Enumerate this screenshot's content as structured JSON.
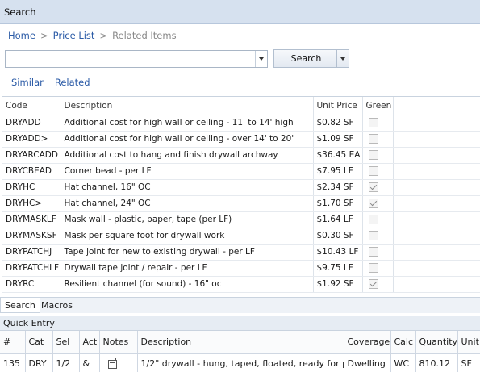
{
  "window": {
    "title": "Search"
  },
  "breadcrumb": {
    "home": "Home",
    "sep": ">",
    "price_list": "Price List",
    "current": "Related Items"
  },
  "search": {
    "value": "",
    "placeholder": "",
    "button_label": "Search"
  },
  "subtabs": {
    "similar": "Similar",
    "related": "Related"
  },
  "results": {
    "headers": {
      "code": "Code",
      "description": "Description",
      "unit_price": "Unit Price",
      "green": "Green"
    },
    "rows": [
      {
        "code": "DRYADD",
        "description": "Additional cost for high wall or ceiling - 11' to 14' high",
        "unit_price": "$0.82 SF",
        "green": false
      },
      {
        "code": "DRYADD>",
        "description": "Additional cost for high wall or ceiling - over 14' to 20'",
        "unit_price": "$1.09 SF",
        "green": false
      },
      {
        "code": "DRYARCADD",
        "description": "Additional cost to hang and finish drywall archway",
        "unit_price": "$36.45 EA",
        "green": false
      },
      {
        "code": "DRYCBEAD",
        "description": "Corner bead - per LF",
        "unit_price": "$7.95 LF",
        "green": false
      },
      {
        "code": "DRYHC",
        "description": "Hat channel, 16\" OC",
        "unit_price": "$2.34 SF",
        "green": true
      },
      {
        "code": "DRYHC>",
        "description": "Hat channel, 24\" OC",
        "unit_price": "$1.70 SF",
        "green": true
      },
      {
        "code": "DRYMASKLF",
        "description": "Mask wall - plastic, paper, tape (per LF)",
        "unit_price": "$1.64 LF",
        "green": false
      },
      {
        "code": "DRYMASKSF",
        "description": "Mask per square foot for drywall work",
        "unit_price": "$0.30 SF",
        "green": false
      },
      {
        "code": "DRYPATCHJ",
        "description": "Tape joint for new to existing drywall - per LF",
        "unit_price": "$10.43 LF",
        "green": false
      },
      {
        "code": "DRYPATCHLF",
        "description": "Drywall tape joint / repair - per LF",
        "unit_price": "$9.75 LF",
        "green": false
      },
      {
        "code": "DRYRC",
        "description": "Resilient channel (for sound) - 16\" oc",
        "unit_price": "$1.92 SF",
        "green": true
      }
    ]
  },
  "bottom_tabs": {
    "search": "Search",
    "macros": "Macros"
  },
  "quick_entry": {
    "title": "Quick Entry",
    "headers": {
      "num": "#",
      "cat": "Cat",
      "sel": "Sel",
      "act": "Act",
      "notes": "Notes",
      "description": "Description",
      "coverage": "Coverage",
      "calc": "Calc",
      "quantity": "Quantity",
      "unit": "Unit"
    },
    "row": {
      "num": "135",
      "cat": "DRY",
      "sel": "1/2",
      "act": "&",
      "notes_icon": "notepad-icon",
      "description": "1/2\" drywall - hung, taped, floated, ready for p",
      "coverage": "Dwelling",
      "calc": "WC",
      "quantity": "810.12",
      "unit": "SF"
    }
  },
  "colors": {
    "titlebar": "#d6e1ef",
    "link": "#2a5aa6"
  }
}
